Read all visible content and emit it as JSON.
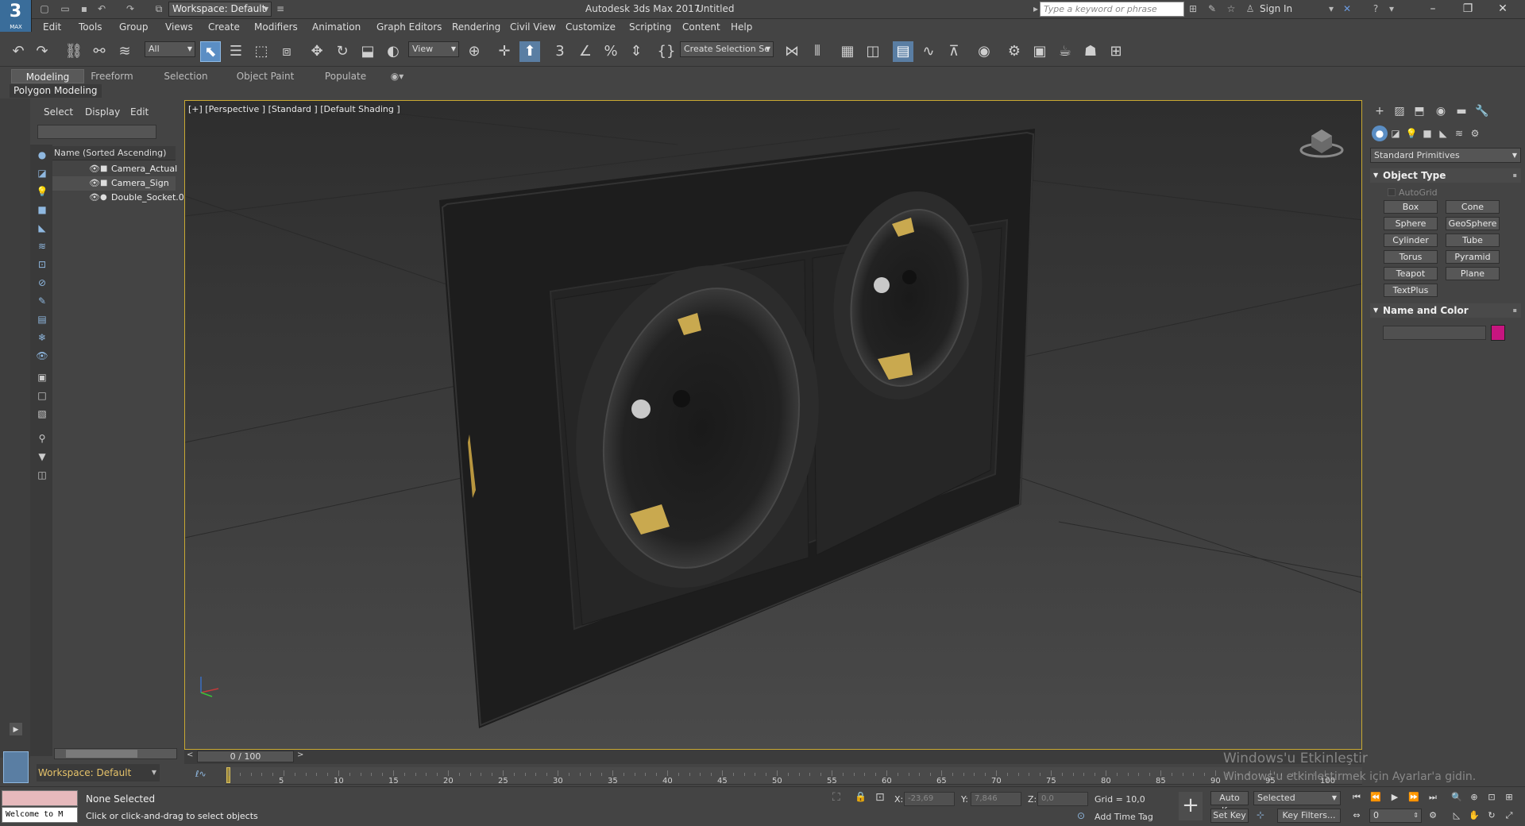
{
  "titlebar": {
    "logo": "3",
    "logo_sub": "MAX",
    "workspace": "Workspace: Default",
    "app_title": "Autodesk 3ds Max 2017",
    "doc_title": "Untitled",
    "search_placeholder": "Type a keyword or phrase",
    "sign_in": "Sign In"
  },
  "menu": [
    "Edit",
    "Tools",
    "Group",
    "Views",
    "Create",
    "Modifiers",
    "Animation",
    "Graph Editors",
    "Rendering",
    "Civil View",
    "Customize",
    "Scripting",
    "Content",
    "Help"
  ],
  "toolbar": {
    "filter_value": "All",
    "refcoord_value": "View",
    "selection_set_value": "Create Selection Se"
  },
  "ribbon": {
    "tabs": [
      "Modeling",
      "Freeform",
      "Selection",
      "Object Paint",
      "Populate"
    ],
    "active_tab": "Modeling",
    "panel_label": "Polygon Modeling"
  },
  "explorer": {
    "tabs": [
      "Select",
      "Display",
      "Edit"
    ],
    "column_header": "Name (Sorted Ascending)",
    "items": [
      {
        "name": "Camera_Actual",
        "type": "camera"
      },
      {
        "name": "Camera_Sign",
        "type": "camera"
      },
      {
        "name": "Double_Socket.001",
        "type": "geometry"
      }
    ],
    "workspace": "Workspace: Default"
  },
  "viewport": {
    "label": "[+] [Perspective ] [Standard ] [Default Shading ]"
  },
  "command_panel": {
    "category": "Standard Primitives",
    "object_type_title": "Object Type",
    "autogrid": "AutoGrid",
    "primitives": [
      "Box",
      "Cone",
      "Sphere",
      "GeoSphere",
      "Cylinder",
      "Tube",
      "Torus",
      "Pyramid",
      "Teapot",
      "Plane",
      "TextPlus"
    ],
    "name_color_title": "Name and Color",
    "color": "#c7157f"
  },
  "timeline": {
    "frame_display": "0 / 100",
    "ticks": [
      "5",
      "10",
      "15",
      "20",
      "25",
      "30",
      "35",
      "40",
      "45",
      "50",
      "55",
      "60",
      "65",
      "70",
      "75",
      "80",
      "85",
      "90",
      "95",
      "100"
    ]
  },
  "status": {
    "welcome": "Welcome to M",
    "line1": "None Selected",
    "line2": "Click or click-and-drag to select objects",
    "x_label": "X:",
    "x_value": "-23,69",
    "y_label": "Y:",
    "y_value": "7,846",
    "z_label": "Z:",
    "z_value": "0,0",
    "grid": "Grid = 10,0",
    "add_time_tag": "Add Time Tag",
    "auto_key": "Auto Key",
    "set_key": "Set Key",
    "selected": "Selected",
    "key_filters": "Key Filters...",
    "frame_value": "0"
  },
  "watermark": {
    "line1": "Windows'u Etkinleştir",
    "line2": "Windows'u etkinleştirmek için Ayarlar'a gidin."
  }
}
